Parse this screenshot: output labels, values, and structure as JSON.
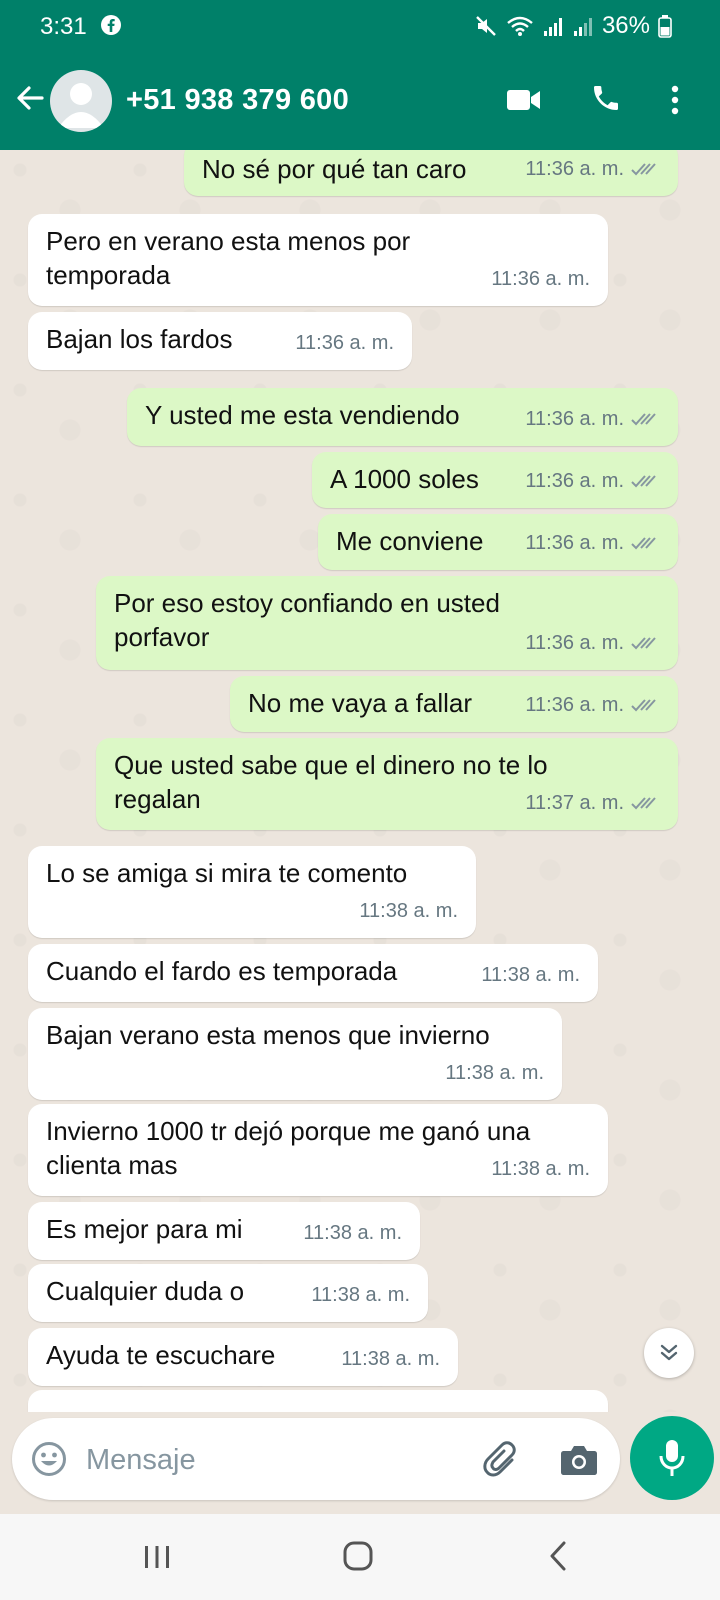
{
  "status_bar": {
    "time": "3:31",
    "battery": "36%"
  },
  "header": {
    "contact": "+51 938 379 600"
  },
  "colors": {
    "header_bg": "#008069",
    "outgoing_bubble": "#dcf8c6",
    "incoming_bubble": "#ffffff",
    "mic_button": "#00a884",
    "chat_bg": "#ece5dd"
  },
  "messages": [
    {
      "dir": "out",
      "text": "No sé por qué tan caro",
      "time": "11:36 a. m."
    },
    {
      "dir": "in",
      "text": "Pero en verano esta menos por temporada",
      "time": "11:36 a. m."
    },
    {
      "dir": "in",
      "text": "Bajan los fardos",
      "time": "11:36 a. m."
    },
    {
      "dir": "out",
      "text": "Y usted me esta vendiendo",
      "time": "11:36 a. m."
    },
    {
      "dir": "out",
      "text": "A 1000 soles",
      "time": "11:36 a. m."
    },
    {
      "dir": "out",
      "text": "Me conviene",
      "time": "11:36 a. m."
    },
    {
      "dir": "out",
      "text": "Por eso estoy confiando en usted porfavor",
      "time": "11:36 a. m."
    },
    {
      "dir": "out",
      "text": "No me vaya a fallar",
      "time": "11:36 a. m."
    },
    {
      "dir": "out",
      "text": "Que usted sabe que el dinero no te lo regalan",
      "time": "11:37 a. m."
    },
    {
      "dir": "in",
      "text": "Lo se amiga si mira te comento",
      "time": "11:38 a. m."
    },
    {
      "dir": "in",
      "text": "Cuando el fardo es temporada",
      "time": "11:38 a. m."
    },
    {
      "dir": "in",
      "text": "Bajan verano esta menos que invierno",
      "time": "11:38 a. m."
    },
    {
      "dir": "in",
      "text": "Invierno  1000 tr dejó porque me ganó una clienta mas",
      "time": "11:38 a. m."
    },
    {
      "dir": "in",
      "text": "Es mejor para mi",
      "time": "11:38 a. m."
    },
    {
      "dir": "in",
      "text": "Cualquier  duda o",
      "time": "11:38 a. m."
    },
    {
      "dir": "in",
      "text": "Ayuda te escuchare",
      "time": "11:38 a. m."
    }
  ],
  "composer": {
    "placeholder": "Mensaje"
  },
  "icons": {
    "header": [
      "back-arrow-icon",
      "avatar",
      "video-call-icon",
      "phone-icon",
      "more-vert-icon"
    ],
    "composer": [
      "emoji-icon",
      "attach-icon",
      "camera-icon",
      "mic-icon"
    ],
    "navbar": [
      "recent-apps-icon",
      "home-icon",
      "back-icon"
    ]
  }
}
